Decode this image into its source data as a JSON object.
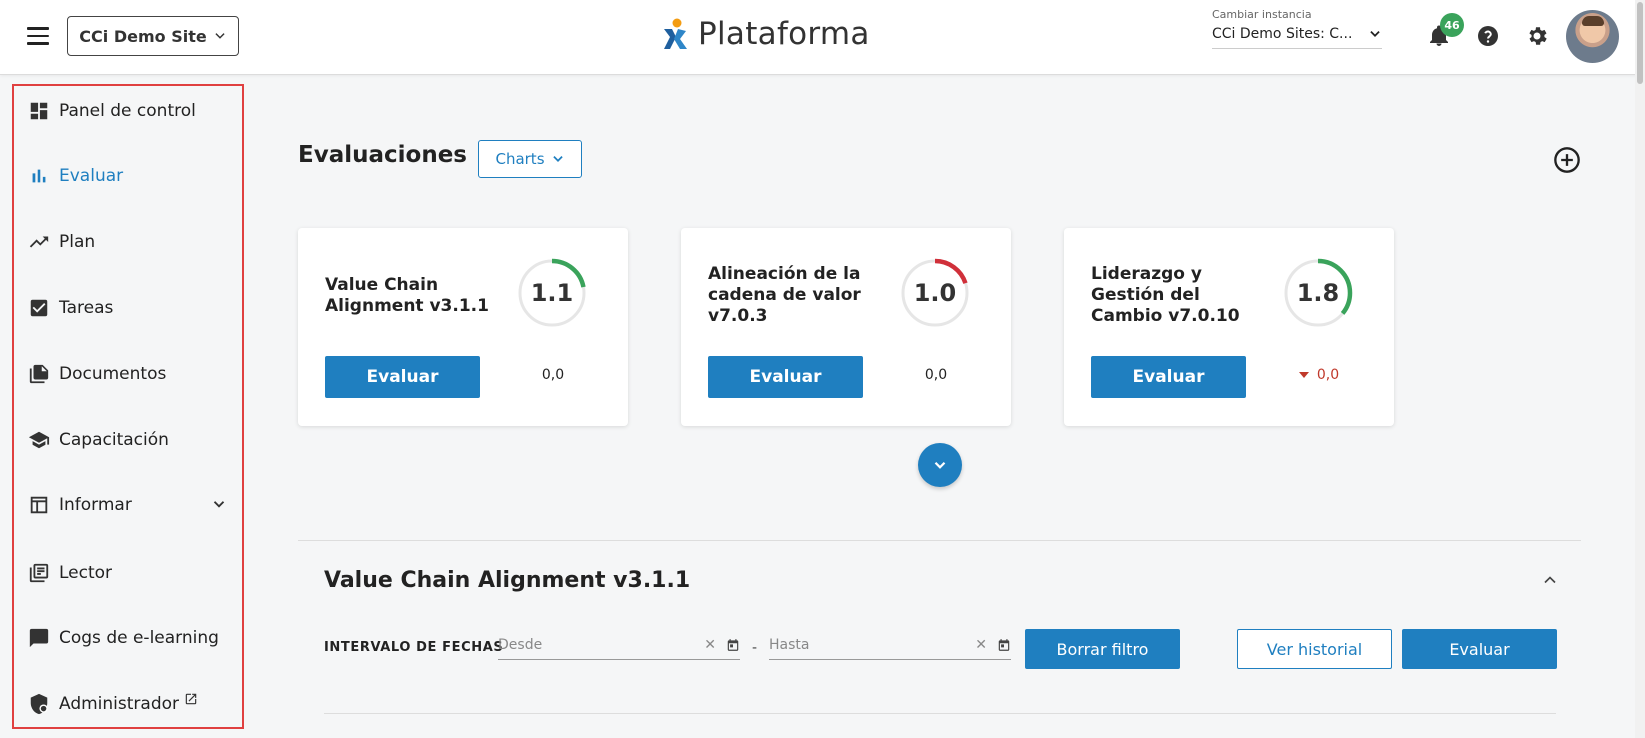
{
  "header": {
    "site_select": "CCi Demo Site",
    "brand": "Plataforma",
    "instance_label": "Cambiar instancia",
    "instance_value": "CCi Demo Sites: C...",
    "notification_count": "46"
  },
  "sidebar": {
    "items": [
      {
        "label": "Panel de control",
        "icon": "dashboard-icon"
      },
      {
        "label": "Evaluar",
        "icon": "bar-chart-icon"
      },
      {
        "label": "Plan",
        "icon": "trending-up-icon"
      },
      {
        "label": "Tareas",
        "icon": "checkbox-icon"
      },
      {
        "label": "Documentos",
        "icon": "documents-icon"
      },
      {
        "label": "Capacitación",
        "icon": "school-icon"
      },
      {
        "label": "Informar",
        "icon": "table-icon"
      },
      {
        "label": "Lector",
        "icon": "library-icon"
      },
      {
        "label": "Cogs de e-learning",
        "icon": "chat-icon"
      },
      {
        "label": "Administrador",
        "icon": "admin-shield-icon"
      }
    ],
    "active_index": 1
  },
  "main": {
    "title": "Evaluaciones",
    "charts_button": "Charts",
    "cards": [
      {
        "title": "Value Chain Alignment v3.1.1",
        "score": "1.1",
        "score_fraction": 0.22,
        "gauge_color": "#3aa35b",
        "button": "Evaluar",
        "delta": "0,0"
      },
      {
        "title": "Alineación de la cadena de valor v7.0.3",
        "score": "1.0",
        "score_fraction": 0.2,
        "gauge_color": "#d0303a",
        "button": "Evaluar",
        "delta": "0,0"
      },
      {
        "title": "Liderazgo y Gestión del Cambio v7.0.10",
        "score": "1.8",
        "score_fraction": 0.36,
        "gauge_color": "#3aa35b",
        "button": "Evaluar",
        "delta": "0,0"
      }
    ],
    "section": {
      "title": "Value Chain Alignment v3.1.1",
      "filter_label": "INTERVALO DE FECHAS",
      "from_placeholder": "Desde",
      "to_placeholder": "Hasta",
      "dash": "-",
      "clear_button": "Borrar filtro",
      "history_button": "Ver historial",
      "evaluate_button": "Evaluar"
    }
  }
}
